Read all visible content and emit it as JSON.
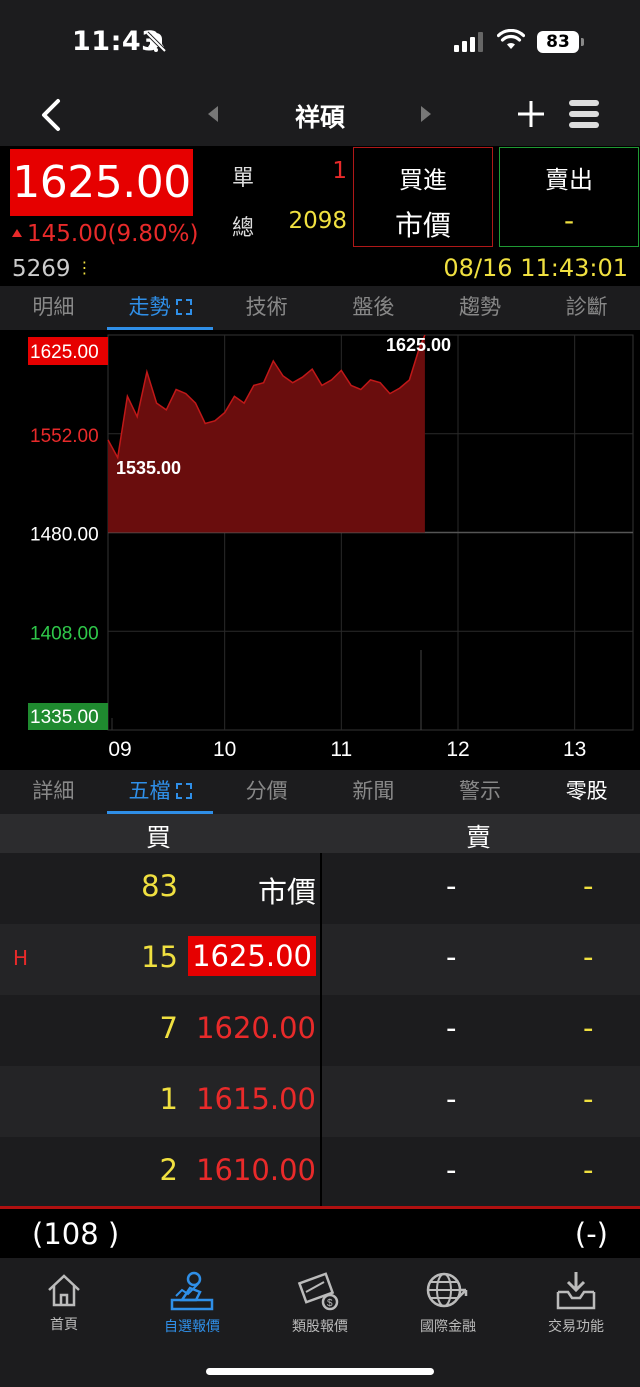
{
  "status_bar": {
    "time": "11:43",
    "battery": "83"
  },
  "nav": {
    "title": "祥碩"
  },
  "quote": {
    "price": "1625.00",
    "change": "145.00(9.80%)",
    "volume": "5269",
    "single_label": "單",
    "single_value": "1",
    "total_label": "總",
    "total_value": "2098",
    "buy_title": "買進",
    "buy_value": "市價",
    "sell_title": "賣出",
    "sell_value": "-",
    "datetime": "08/16 11:43:01"
  },
  "top_tabs": [
    "明細",
    "走勢",
    "技術",
    "盤後",
    "趨勢",
    "診斷"
  ],
  "chart_data": {
    "type": "area",
    "y_ticks": [
      "1625.00",
      "1552.00",
      "1480.00",
      "1408.00",
      "1335.00"
    ],
    "x_ticks": [
      "09",
      "10",
      "11",
      "12",
      "13"
    ],
    "ylim": [
      1335,
      1625
    ],
    "reference": 1480,
    "high_label": "1625.00",
    "low_label": "1535.00",
    "series": [
      {
        "x": [
          "09:00",
          "09:05",
          "09:10",
          "09:15",
          "09:20",
          "09:25",
          "09:30",
          "09:35",
          "09:40",
          "09:45",
          "09:50",
          "09:55",
          "10:00",
          "10:05",
          "10:10",
          "10:15",
          "10:20",
          "10:25",
          "10:30",
          "10:35",
          "10:40",
          "10:45",
          "10:50",
          "10:55",
          "11:00",
          "11:05",
          "11:10",
          "11:15",
          "11:20",
          "11:25",
          "11:30",
          "11:35",
          "11:40",
          "11:43"
        ],
        "values": [
          1548,
          1535,
          1580,
          1565,
          1598,
          1575,
          1570,
          1585,
          1582,
          1575,
          1560,
          1562,
          1568,
          1580,
          1575,
          1588,
          1590,
          1606,
          1595,
          1590,
          1594,
          1600,
          1588,
          1592,
          1599,
          1588,
          1585,
          1592,
          1590,
          1582,
          1586,
          1592,
          1615,
          1625
        ]
      }
    ]
  },
  "bottom_tabs": [
    "詳細",
    "五檔",
    "分價",
    "新聞",
    "警示",
    "零股"
  ],
  "book": {
    "buy_header": "買",
    "sell_header": "賣",
    "rows": [
      {
        "mark": "",
        "qty": "83",
        "price": "市價",
        "sell_price": "-",
        "sell_qty": "-"
      },
      {
        "mark": "H",
        "qty": "15",
        "price": "1625.00",
        "sell_price": "-",
        "sell_qty": "-"
      },
      {
        "mark": "",
        "qty": "7",
        "price": "1620.00",
        "sell_price": "-",
        "sell_qty": "-"
      },
      {
        "mark": "",
        "qty": "1",
        "price": "1615.00",
        "sell_price": "-",
        "sell_qty": "-"
      },
      {
        "mark": "",
        "qty": "2",
        "price": "1610.00",
        "sell_price": "-",
        "sell_qty": "-"
      }
    ],
    "total_buy": "(108 )",
    "total_sell": "(-)"
  },
  "bottom_nav": [
    "首頁",
    "自選報價",
    "類股報價",
    "國際金融",
    "交易功能"
  ]
}
